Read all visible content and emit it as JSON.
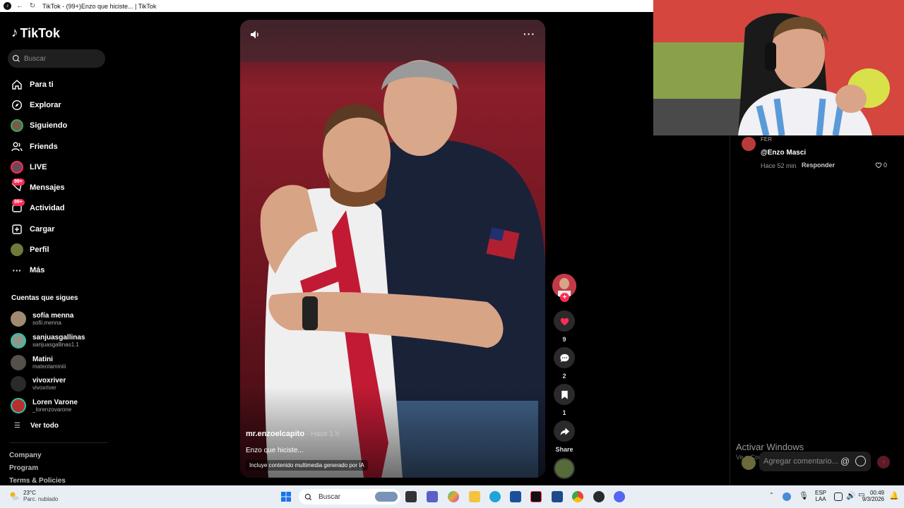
{
  "browser": {
    "tab_title": "TikTok - (99+)Enzo que hiciste... | TikTok"
  },
  "sidebar": {
    "logo": "TikTok",
    "search_placeholder": "Buscar",
    "nav": [
      {
        "label": "Para ti",
        "icon": "home-icon"
      },
      {
        "label": "Explorar",
        "icon": "compass-icon"
      },
      {
        "label": "Siguiendo",
        "icon": "following-avatar-icon"
      },
      {
        "label": "Friends",
        "icon": "friends-icon"
      },
      {
        "label": "LIVE",
        "icon": "live-icon"
      },
      {
        "label": "Mensajes",
        "icon": "messages-icon",
        "badge": "99+"
      },
      {
        "label": "Actividad",
        "icon": "activity-icon",
        "badge": "99+"
      },
      {
        "label": "Cargar",
        "icon": "upload-icon"
      },
      {
        "label": "Perfil",
        "icon": "profile-icon"
      },
      {
        "label": "Más",
        "icon": "more-dots-icon"
      }
    ],
    "following_title": "Cuentas que sigues",
    "following": [
      {
        "name": "sofía menna",
        "user": "sofii.menna"
      },
      {
        "name": "sanjuasgallinas",
        "user": "sanjuasgallinas1.1"
      },
      {
        "name": "Matini",
        "user": "mateotaminiii"
      },
      {
        "name": "vivoxriver",
        "user": "vivoxriver"
      },
      {
        "name": "Loren Varone",
        "user": "_lorenzovarone"
      }
    ],
    "see_all": "Ver todo",
    "footer": [
      "Company",
      "Program",
      "Terms & Policies"
    ]
  },
  "video": {
    "author": "mr.enzoelcapito",
    "time": "· Hace 1 h",
    "caption": "Enzo que hiciste...",
    "ai_label": "Incluye contenido multimedia generado por IA"
  },
  "actions": {
    "likes": "9",
    "comments": "2",
    "saves": "1",
    "share": "Share"
  },
  "comments": {
    "user": "FER",
    "text": "@Enzo Masci",
    "time": "Hace 52 min",
    "reply": "Responder",
    "likes": "0",
    "input_placeholder": "Agregar comentario...",
    "at_symbol": "@"
  },
  "windows_watermark": {
    "title": "Activar Windows",
    "subtitle": "Ve a Configuración para activar Windows."
  },
  "taskbar": {
    "temp": "23°C",
    "weather": "Parc. nublado",
    "search": "Buscar",
    "lang": "ESP",
    "lang2": "LAA",
    "time": "00:49",
    "date": "9/3/2026"
  },
  "colors": {
    "accent": "#fe2c55",
    "sidebar_bg": "#000000",
    "taskbar_bg": "#e9eef5"
  }
}
